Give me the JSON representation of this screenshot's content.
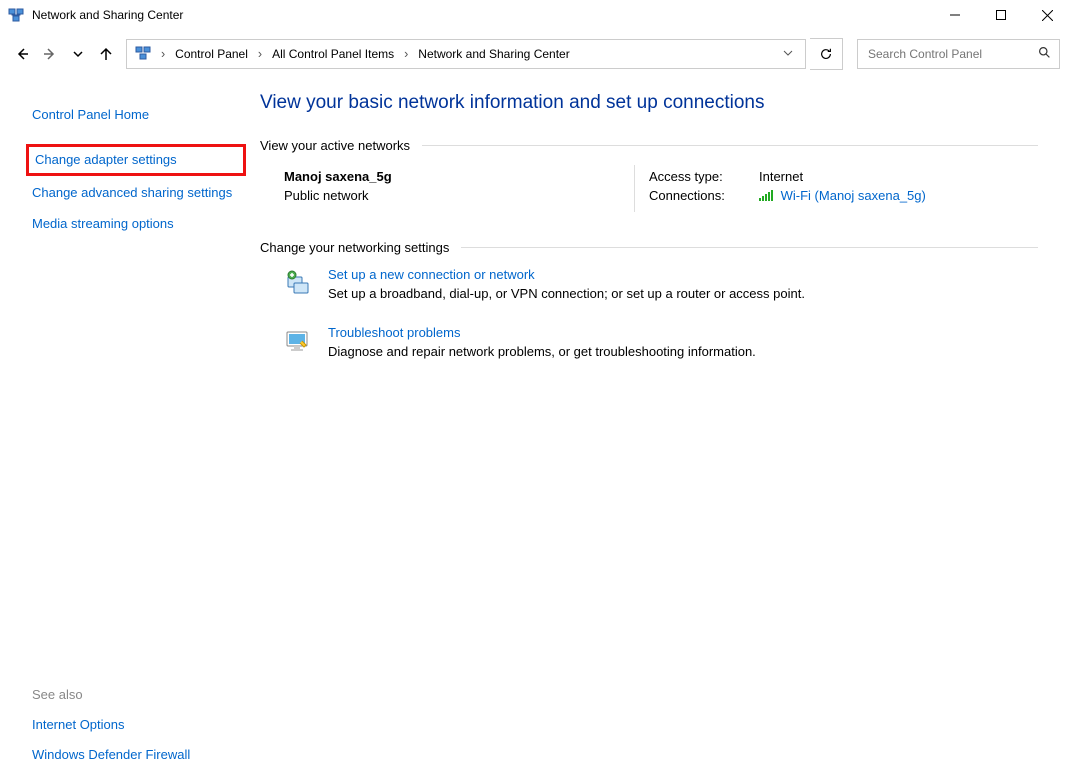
{
  "window": {
    "title": "Network and Sharing Center"
  },
  "breadcrumb": {
    "items": [
      "Control Panel",
      "All Control Panel Items",
      "Network and Sharing Center"
    ]
  },
  "search": {
    "placeholder": "Search Control Panel"
  },
  "sidebar": {
    "home": "Control Panel Home",
    "links": [
      "Change adapter settings",
      "Change advanced sharing settings",
      "Media streaming options"
    ],
    "see_also_label": "See also",
    "see_also": [
      "Internet Options",
      "Windows Defender Firewall"
    ]
  },
  "main": {
    "heading": "View your basic network information and set up connections",
    "active_hdr": "View your active networks",
    "network": {
      "name": "Manoj saxena_5g",
      "type": "Public network",
      "access_label": "Access type:",
      "access_value": "Internet",
      "conn_label": "Connections:",
      "conn_value": "Wi-Fi (Manoj saxena_5g)"
    },
    "change_hdr": "Change your networking settings",
    "tasks": [
      {
        "title": "Set up a new connection or network",
        "desc": "Set up a broadband, dial-up, or VPN connection; or set up a router or access point."
      },
      {
        "title": "Troubleshoot problems",
        "desc": "Diagnose and repair network problems, or get troubleshooting information."
      }
    ]
  }
}
